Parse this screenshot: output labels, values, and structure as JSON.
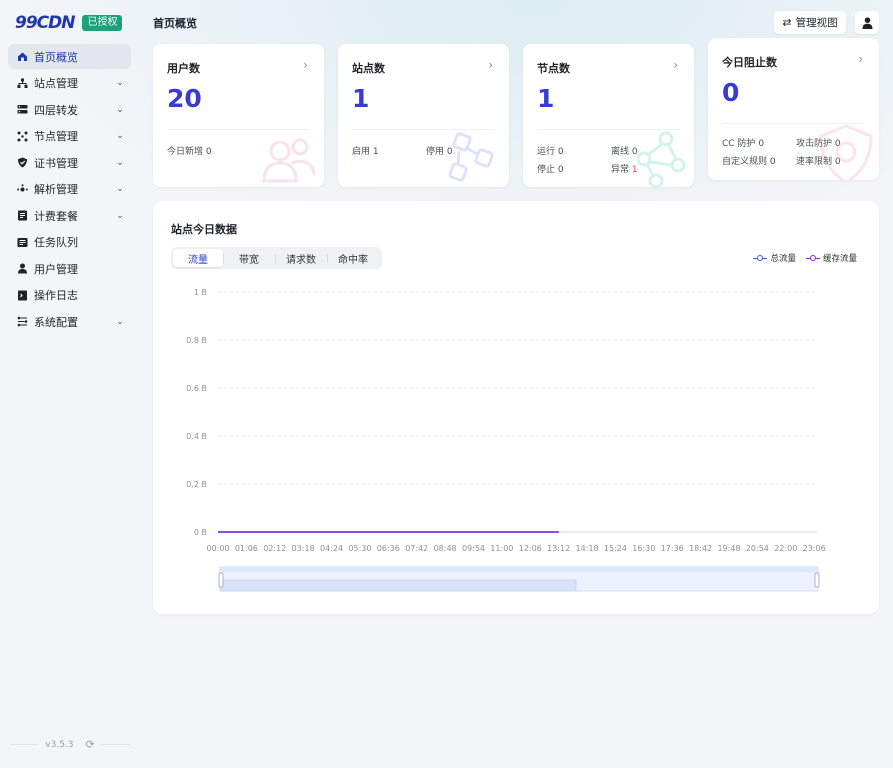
{
  "app": {
    "logo": "99CDN",
    "license_badge": "已授权",
    "version": "v3.5.3"
  },
  "header": {
    "title": "首页概览",
    "view_button": "管理视图"
  },
  "sidebar": {
    "items": [
      {
        "label": "首页概览",
        "icon": "home-icon",
        "expandable": false,
        "active": true
      },
      {
        "label": "站点管理",
        "icon": "sitemap-icon",
        "expandable": true
      },
      {
        "label": "四层转发",
        "icon": "server-icon",
        "expandable": true
      },
      {
        "label": "节点管理",
        "icon": "nodes-icon",
        "expandable": true
      },
      {
        "label": "证书管理",
        "icon": "shield-icon",
        "expandable": true
      },
      {
        "label": "解析管理",
        "icon": "dns-icon",
        "expandable": true
      },
      {
        "label": "计费套餐",
        "icon": "billing-icon",
        "expandable": true
      },
      {
        "label": "任务队列",
        "icon": "queue-icon",
        "expandable": false
      },
      {
        "label": "用户管理",
        "icon": "user-icon",
        "expandable": false
      },
      {
        "label": "操作日志",
        "icon": "log-icon",
        "expandable": false
      },
      {
        "label": "系统配置",
        "icon": "config-icon",
        "expandable": true
      }
    ]
  },
  "cards": {
    "users": {
      "title": "用户数",
      "value": "20",
      "new_label": "今日新增",
      "new_value": "0"
    },
    "sites": {
      "title": "站点数",
      "value": "1",
      "enabled_label": "启用",
      "enabled_value": "1",
      "disabled_label": "停用",
      "disabled_value": "0"
    },
    "nodes": {
      "title": "节点数",
      "value": "1",
      "running_label": "运行",
      "running_value": "0",
      "offline_label": "离线",
      "offline_value": "0",
      "stopped_label": "停止",
      "stopped_value": "0",
      "abnormal_label": "异常",
      "abnormal_value": "1"
    },
    "blocked": {
      "title": "今日阻止数",
      "value": "0",
      "cc_label": "CC 防护",
      "cc_value": "0",
      "attack_label": "攻击防护",
      "attack_value": "0",
      "custom_label": "自定义规则",
      "custom_value": "0",
      "rate_label": "速率限制",
      "rate_value": "0"
    }
  },
  "panel": {
    "title": "站点今日数据",
    "tabs": [
      "流量",
      "带宽",
      "请求数",
      "命中率"
    ],
    "active_tab": 0
  },
  "colors": {
    "accent": "#2b3ec4",
    "total_series": "#3b5bdb",
    "cache_series": "#8a2be2",
    "abnormal": "#e5484d",
    "badge": "#1aa37a"
  },
  "chart_data": {
    "type": "line",
    "title": "",
    "y_ticks": [
      "0 B",
      "0.2 B",
      "0.4 B",
      "0.6 B",
      "0.8 B",
      "1 B"
    ],
    "ylim": [
      0,
      1
    ],
    "grid": true,
    "legend_position": "top-right",
    "x": [
      "00:00",
      "01:06",
      "02:12",
      "03:18",
      "04:24",
      "05:30",
      "06:36",
      "07:42",
      "08:48",
      "09:54",
      "11:00",
      "12:06",
      "13:12",
      "14:18",
      "15:24",
      "16:30",
      "17:36",
      "18:42",
      "19:48",
      "20:54",
      "22:00",
      "23:06"
    ],
    "series": [
      {
        "name": "总流量",
        "values": [
          0,
          0,
          0,
          0,
          0,
          0,
          0,
          0,
          0,
          0,
          0,
          0,
          0,
          null,
          null,
          null,
          null,
          null,
          null,
          null,
          null,
          null
        ]
      },
      {
        "name": "缓存流量",
        "values": [
          0,
          0,
          0,
          0,
          0,
          0,
          0,
          0,
          0,
          0,
          0,
          0,
          0,
          null,
          null,
          null,
          null,
          null,
          null,
          null,
          null,
          null
        ]
      }
    ],
    "data_zoom": {
      "start": 0,
      "end": 1
    }
  }
}
